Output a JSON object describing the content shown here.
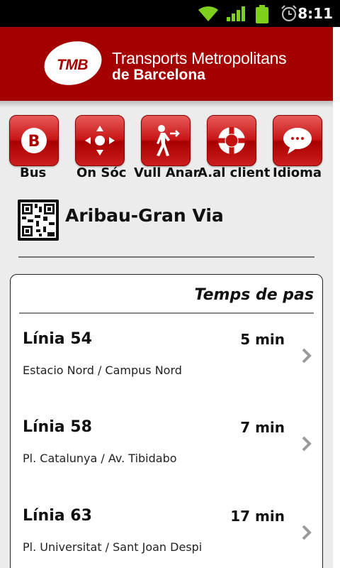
{
  "status_bar": {
    "time": "8:11",
    "icons": [
      "wifi-icon",
      "signal-icon",
      "battery-icon",
      "alarm-icon"
    ]
  },
  "header": {
    "logo_text": "TMB",
    "brand_line1": "Transports Metropolitans",
    "brand_line2": "de Barcelona",
    "colors": {
      "brand_red": "#a50000",
      "text": "#ffffff"
    }
  },
  "nav": {
    "items": [
      {
        "label": "Bus",
        "icon": "bus-icon"
      },
      {
        "label": "On Sóc",
        "icon": "location-icon"
      },
      {
        "label": "Vull Anar",
        "icon": "walking-person-icon"
      },
      {
        "label": "A.al client",
        "icon": "lifebuoy-icon"
      },
      {
        "label": "Idioma",
        "icon": "speech-bubble-icon"
      }
    ]
  },
  "stop": {
    "name": "Aribau-Gran Via",
    "code_icon": "qr-code-icon"
  },
  "departures": {
    "title": "Temps de pas",
    "rows": [
      {
        "line": "Línia 54",
        "time": "5 min",
        "route": "Estacio Nord / Campus Nord"
      },
      {
        "line": "Línia 58",
        "time": "7 min",
        "route": "Pl. Catalunya / Av. Tibidabo"
      },
      {
        "line": "Línia 63",
        "time": "17 min",
        "route": "Pl. Universitat / Sant Joan Despi"
      }
    ]
  }
}
